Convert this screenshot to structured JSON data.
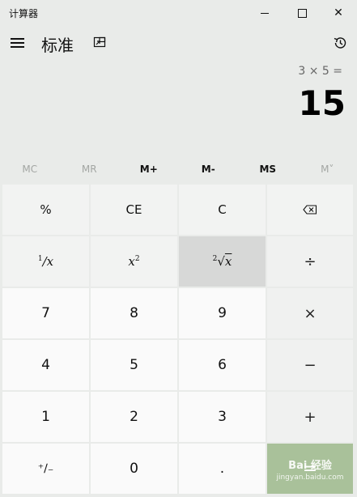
{
  "window": {
    "title": "计算器",
    "min_icon": "minimize-icon",
    "max_icon": "maximize-icon",
    "close_icon": "close-icon",
    "close_glyph": "✕"
  },
  "header": {
    "menu_icon": "hamburger-menu-icon",
    "mode": "标准",
    "keep_on_top_icon": "keep-on-top-icon",
    "history_icon": "history-icon"
  },
  "display": {
    "expression": "3 × 5 =",
    "result": "15"
  },
  "memory": [
    {
      "label": "MC",
      "enabled": false
    },
    {
      "label": "MR",
      "enabled": false
    },
    {
      "label": "M+",
      "enabled": true
    },
    {
      "label": "M-",
      "enabled": true
    },
    {
      "label": "MS",
      "enabled": true
    },
    {
      "label": "M˅",
      "enabled": false
    }
  ],
  "keys": {
    "percent": "%",
    "clear_entry": "CE",
    "clear": "C",
    "backspace_icon": "backspace-icon",
    "reciprocal_num": "1",
    "reciprocal_den": "x",
    "square_base": "x",
    "square_exp": "2",
    "sqrt_index": "2",
    "sqrt_var": "x",
    "divide": "÷",
    "seven": "7",
    "eight": "8",
    "nine": "9",
    "multiply": "×",
    "four": "4",
    "five": "5",
    "six": "6",
    "subtract": "−",
    "one": "1",
    "two": "2",
    "three": "3",
    "add": "+",
    "negate": "⁺∕₋",
    "zero": "0",
    "decimal": ".",
    "equals": "=",
    "watermark": "Bai 经验",
    "watermark_sub": "jingyan.baidu.com"
  },
  "colors": {
    "background": "#e9ebe9",
    "equals_key": "#a9c19a",
    "pressed_key": "#d7d8d7"
  }
}
